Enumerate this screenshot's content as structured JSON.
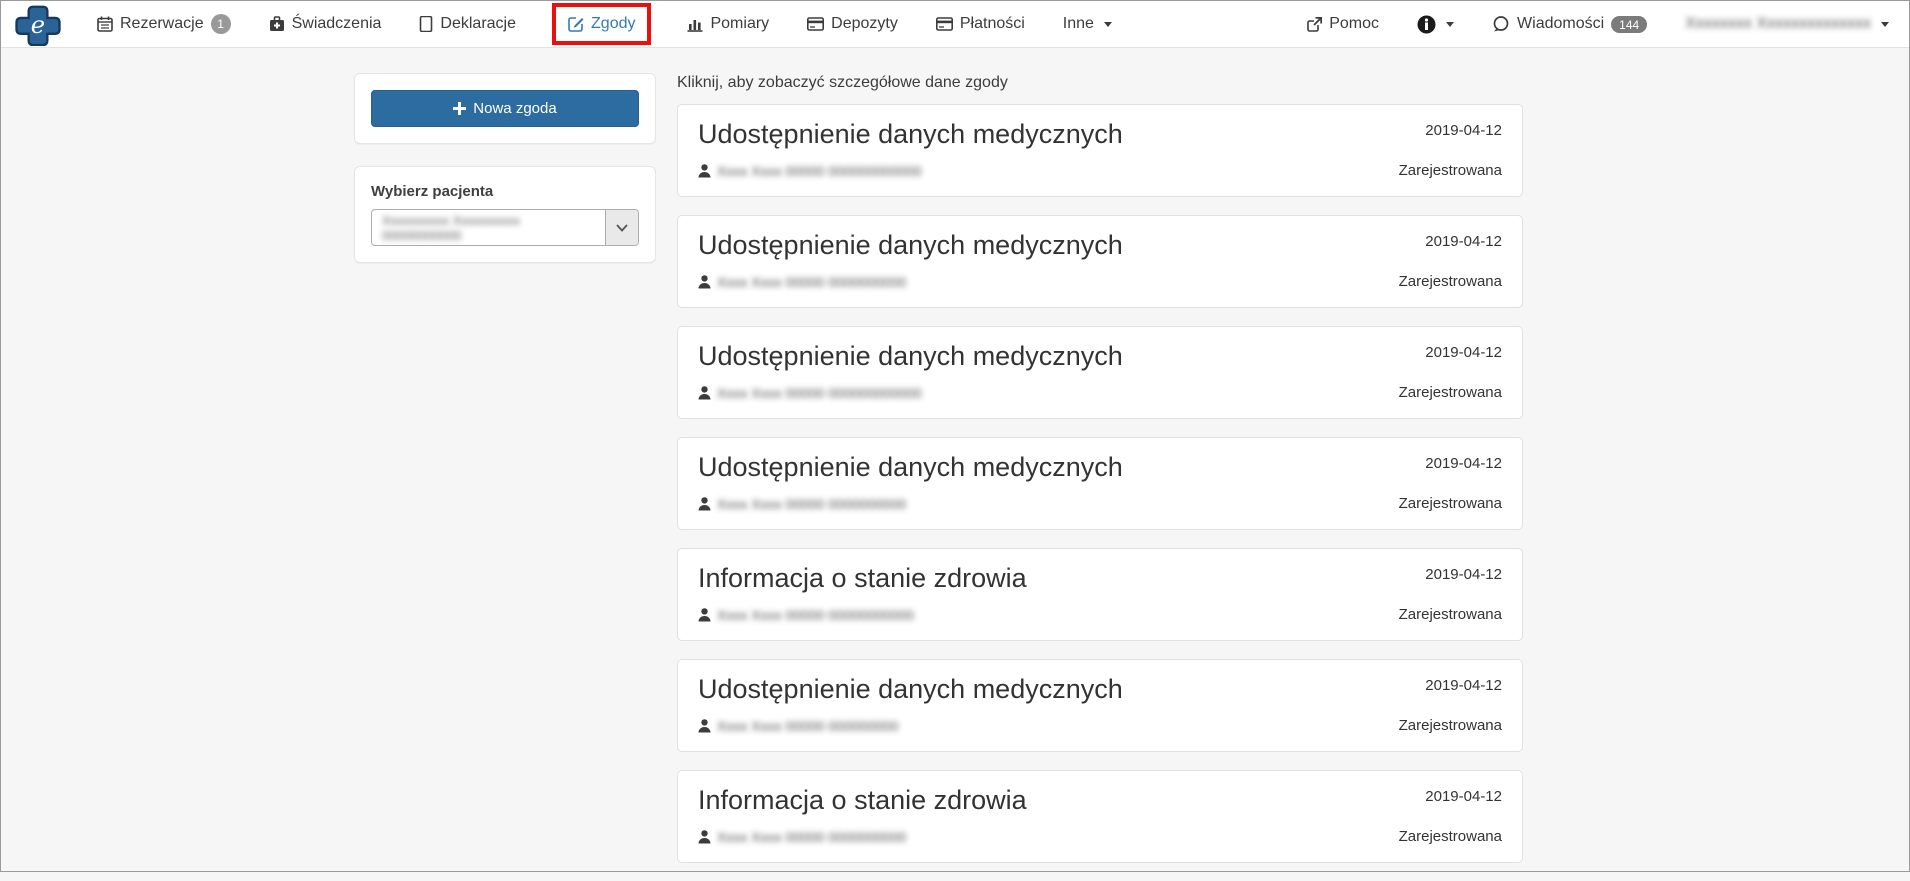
{
  "navbar": {
    "logo_letter": "e",
    "items": [
      {
        "label": "Rezerwacje",
        "badge": "1"
      },
      {
        "label": "Świadczenia"
      },
      {
        "label": "Deklaracje"
      },
      {
        "label": "Zgody",
        "active": true
      },
      {
        "label": "Pomiary"
      },
      {
        "label": "Depozyty"
      },
      {
        "label": "Płatności"
      },
      {
        "label": "Inne"
      }
    ],
    "help_label": "Pomoc",
    "messages_label": "Wiadomości",
    "messages_badge": "144",
    "user_name_redacted": "Xxxxxxxx Xxxxxxxxxxxxxx"
  },
  "sidebar": {
    "new_consent_button": "Nowa zgoda",
    "choose_patient_label": "Wybierz pacjenta",
    "patient_select_value_redacted": "Xxxxxxxxxx Xxxxxxxxxx 00000000000"
  },
  "main": {
    "hint": "Kliknij, aby zobaczyć szczegółowe dane zgody",
    "consents": [
      {
        "title": "Udostępnienie danych medycznych",
        "patient_redacted": "Xxxx Xxxx 00000 000000000000",
        "date": "2019-04-12",
        "status": "Zarejestrowana"
      },
      {
        "title": "Udostępnienie danych medycznych",
        "patient_redacted": "Xxxx Xxxx 00000 0000000000",
        "date": "2019-04-12",
        "status": "Zarejestrowana"
      },
      {
        "title": "Udostępnienie danych medycznych",
        "patient_redacted": "Xxxx Xxxx 00000 000000000000",
        "date": "2019-04-12",
        "status": "Zarejestrowana"
      },
      {
        "title": "Udostępnienie danych medycznych",
        "patient_redacted": "Xxxx Xxxx 00000 0000000000",
        "date": "2019-04-12",
        "status": "Zarejestrowana"
      },
      {
        "title": "Informacja o stanie zdrowia",
        "patient_redacted": "Xxxx Xxxx 00000 00000000000",
        "date": "2019-04-12",
        "status": "Zarejestrowana"
      },
      {
        "title": "Udostępnienie danych medycznych",
        "patient_redacted": "Xxxx Xxxx 00000 000000000",
        "date": "2019-04-12",
        "status": "Zarejestrowana"
      },
      {
        "title": "Informacja o stanie zdrowia",
        "patient_redacted": "Xxxx Xxxx 00000 0000000000",
        "date": "2019-04-12",
        "status": "Zarejestrowana"
      }
    ]
  },
  "colors": {
    "accent_button": "#2c6ca0",
    "active_link": "#337ab7",
    "annotation_red": "#e9100e",
    "badge_gray": "#999999",
    "pill_gray": "#7b7b7b"
  }
}
